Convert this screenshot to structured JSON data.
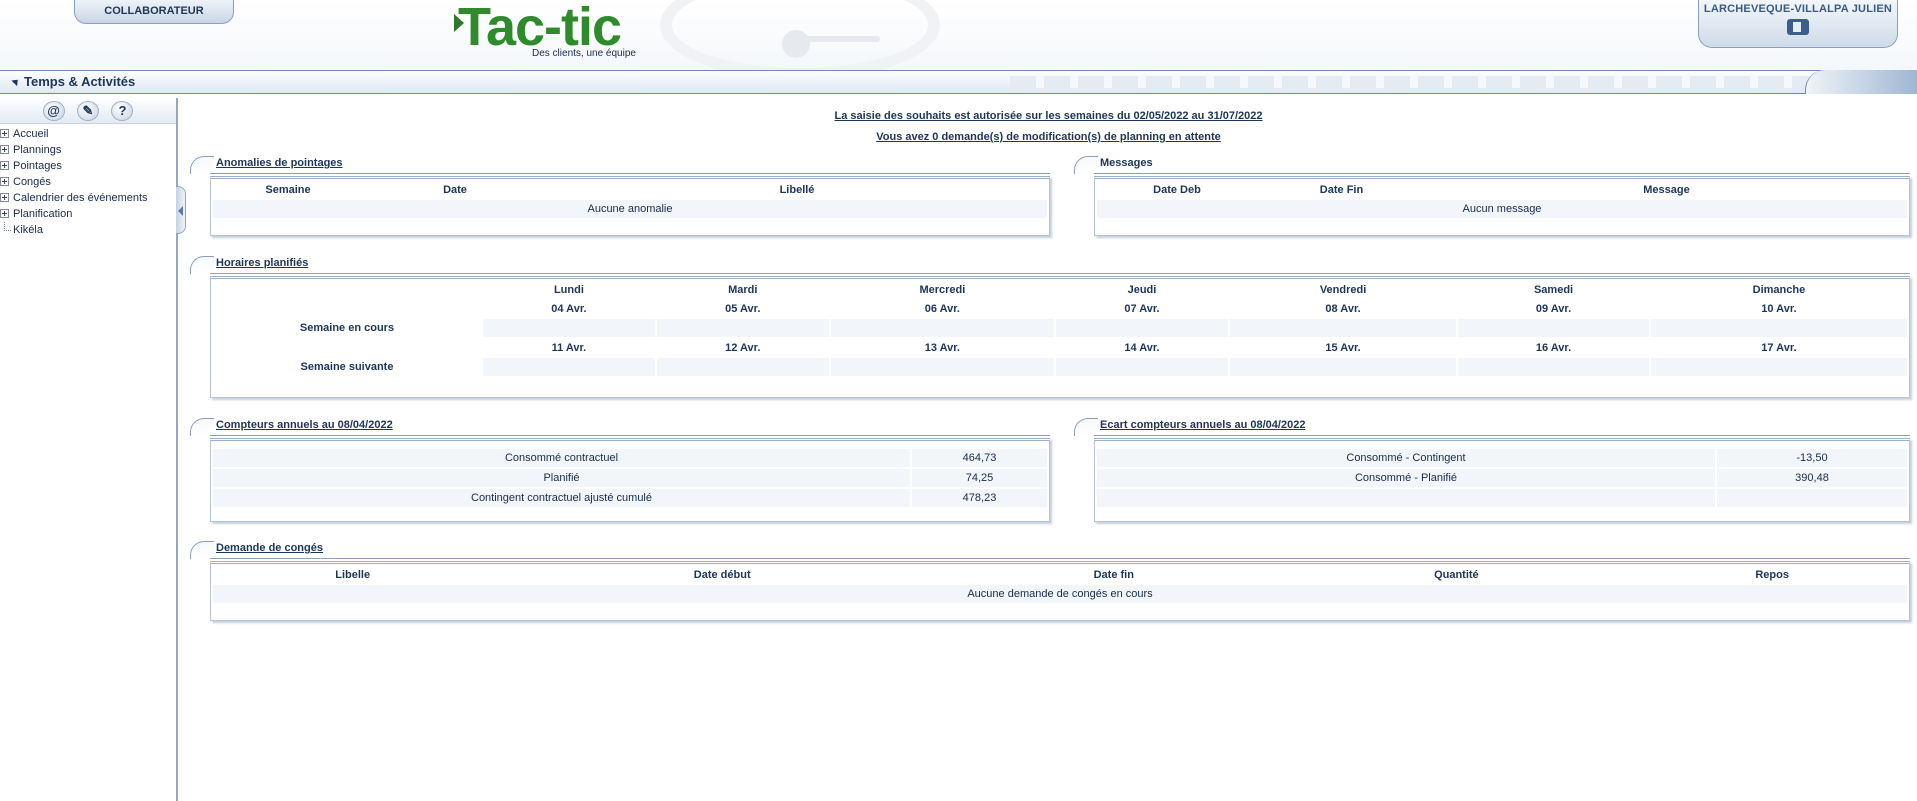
{
  "header": {
    "collab_tab": "COLLABORATEUR",
    "logo_text": "Tac-tic",
    "logo_tagline": "Des clients, une équipe",
    "user_name": "LARCHEVEQUE-VILLALPA JULIEN"
  },
  "titlebar": {
    "title": "Temps & Activités"
  },
  "sidebar": {
    "icons": [
      "@",
      "✎",
      "?"
    ],
    "items": [
      {
        "label": "Accueil"
      },
      {
        "label": "Plannings"
      },
      {
        "label": "Pointages"
      },
      {
        "label": "Congés"
      },
      {
        "label": "Calendrier des événements"
      },
      {
        "label": "Planification"
      },
      {
        "label": "Kikéla"
      }
    ]
  },
  "notices": {
    "saisie": "La saisie des souhaits est autorisée sur les semaines du 02/05/2022 au 31/07/2022",
    "demandes": "Vous avez 0 demande(s) de modification(s) de planning en attente"
  },
  "anomalies": {
    "title": "Anomalies de pointages",
    "headers": [
      "Semaine",
      "Date",
      "Libellé"
    ],
    "empty": "Aucune anomalie"
  },
  "messages": {
    "title": "Messages",
    "headers": [
      "Date Deb",
      "Date Fin",
      "Message"
    ],
    "empty": "Aucun message"
  },
  "horaires": {
    "title": "Horaires planifiés",
    "days": [
      "Lundi",
      "Mardi",
      "Mercredi",
      "Jeudi",
      "Vendredi",
      "Samedi",
      "Dimanche"
    ],
    "week1": {
      "label": "Semaine en cours",
      "dates": [
        "04 Avr.",
        "05 Avr.",
        "06 Avr.",
        "07 Avr.",
        "08 Avr.",
        "09 Avr.",
        "10 Avr."
      ]
    },
    "week2": {
      "label": "Semaine suivante",
      "dates": [
        "11 Avr.",
        "12 Avr.",
        "13 Avr.",
        "14 Avr.",
        "15 Avr.",
        "16 Avr.",
        "17 Avr."
      ]
    }
  },
  "compteurs": {
    "title": "Compteurs annuels au 08/04/2022",
    "rows": [
      {
        "label": "Consommé contractuel",
        "value": "464,73"
      },
      {
        "label": "Planifié",
        "value": "74,25"
      },
      {
        "label": "Contingent contractuel ajusté cumulé",
        "value": "478,23"
      }
    ]
  },
  "ecart": {
    "title": "Ecart compteurs annuels au 08/04/2022",
    "rows": [
      {
        "label": "Consommé - Contingent",
        "value": "-13,50"
      },
      {
        "label": "Consommé - Planifié",
        "value": "390,48"
      }
    ]
  },
  "conges": {
    "title": "Demande de congés",
    "headers": [
      "Libelle",
      "Date début",
      "Date fin",
      "Quantité",
      "Repos"
    ],
    "empty": "Aucune demande de congés en cours"
  }
}
